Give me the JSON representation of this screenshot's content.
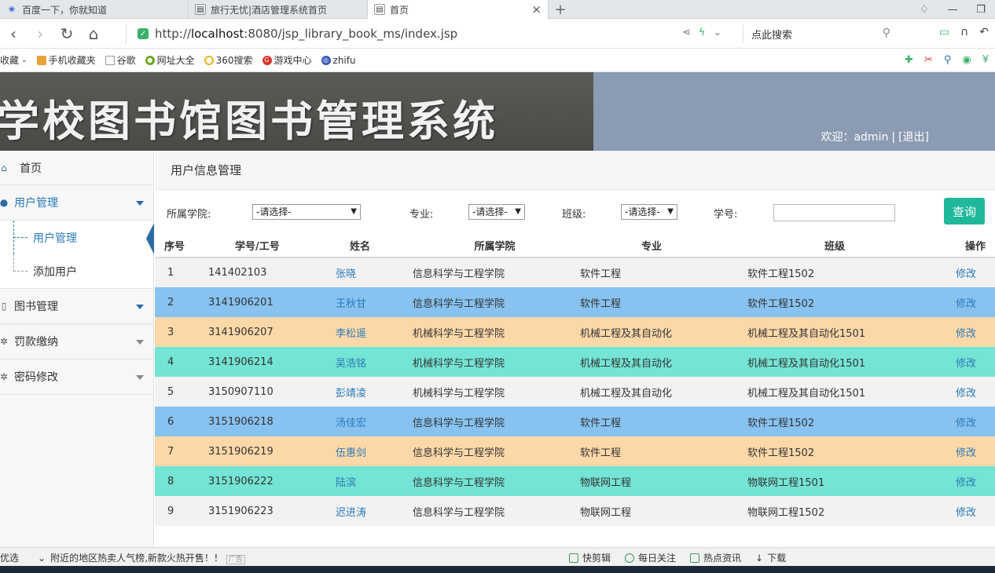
{
  "browser": {
    "tabs": [
      {
        "title": "百度一下，你就知道",
        "icon": "paw-icon"
      },
      {
        "title": "旅行无忧|酒店管理系统首页",
        "icon": "page-icon"
      },
      {
        "title": "首页",
        "icon": "page-icon",
        "active": true
      }
    ],
    "new_tab": "+",
    "url_prefix": "http://",
    "url_host": "localhost",
    "url_rest": ":8080/jsp_library_book_ms/index.jsp",
    "search_placeholder": "点此搜索",
    "bookmarks": [
      "收藏",
      "手机收藏夹",
      "谷歌",
      "网址大全",
      "360搜索",
      "游戏中心",
      "zhifu"
    ]
  },
  "header": {
    "system_title": "学校图书馆图书管理系统",
    "welcome_prefix": "欢迎：",
    "username": "admin",
    "separator": "|",
    "logout": "[退出]",
    "bg_color": "#8a9bb2"
  },
  "sidebar": {
    "home": "首页",
    "user_mgmt": "用户管理",
    "user_sub": [
      "用户管理",
      "添加用户"
    ],
    "book_mgmt": "图书管理",
    "fines": "罚款缴纳",
    "password": "密码修改"
  },
  "main": {
    "breadcrumb": "用户信息管理",
    "filters": {
      "college_label": "所属学院:",
      "college_value": "-请选择-",
      "major_label": "专业:",
      "major_value": "-请选择-",
      "class_label": "班级:",
      "class_value": "-请选择-",
      "sid_label": "学号:",
      "query_button": "查询"
    },
    "columns": [
      "序号",
      "学号/工号",
      "姓名",
      "所属学院",
      "专业",
      "班级",
      "操作"
    ],
    "rows": [
      {
        "no": "1",
        "id": "141402103",
        "name": "张晓",
        "college": "信息科学与工程学院",
        "major": "软件工程",
        "class": "软件工程1502",
        "op": "修改",
        "style": "r-gray"
      },
      {
        "no": "2",
        "id": "3141906201",
        "name": "王秋甘",
        "college": "信息科学与工程学院",
        "major": "软件工程",
        "class": "软件工程1502",
        "op": "修改",
        "style": "r-blue"
      },
      {
        "no": "3",
        "id": "3141906207",
        "name": "李松遥",
        "college": "机械科学与工程学院",
        "major": "机械工程及其自动化",
        "class": "机械工程及其自动化1501",
        "op": "修改",
        "style": "r-orange"
      },
      {
        "no": "4",
        "id": "3141906214",
        "name": "吴浩铭",
        "college": "机械科学与工程学院",
        "major": "机械工程及其自动化",
        "class": "机械工程及其自动化1501",
        "op": "修改",
        "style": "r-teal"
      },
      {
        "no": "5",
        "id": "3150907110",
        "name": "彭靖凌",
        "college": "机械科学与工程学院",
        "major": "机械工程及其自动化",
        "class": "机械工程及其自动化1501",
        "op": "修改",
        "style": "r-light"
      },
      {
        "no": "6",
        "id": "3151906218",
        "name": "汤佳宏",
        "college": "信息科学与工程学院",
        "major": "软件工程",
        "class": "软件工程1502",
        "op": "修改",
        "style": "r-blue"
      },
      {
        "no": "7",
        "id": "3151906219",
        "name": "伍惠剑",
        "college": "信息科学与工程学院",
        "major": "软件工程",
        "class": "软件工程1502",
        "op": "修改",
        "style": "r-orange"
      },
      {
        "no": "8",
        "id": "3151906222",
        "name": "陆滨",
        "college": "信息科学与工程学院",
        "major": "物联网工程",
        "class": "物联网工程1501",
        "op": "修改",
        "style": "r-teal"
      },
      {
        "no": "9",
        "id": "3151906223",
        "name": "迟进涛",
        "college": "信息科学与工程学院",
        "major": "物联网工程",
        "class": "物联网工程1502",
        "op": "修改",
        "style": "r-light"
      }
    ]
  },
  "statusbar": {
    "left": "优选",
    "ticker": "附近的地区热卖人气榜,新款火热开售！！",
    "tag": "广告",
    "tools": [
      "快剪辑",
      "每日关注",
      "热点资讯",
      "下载"
    ]
  }
}
